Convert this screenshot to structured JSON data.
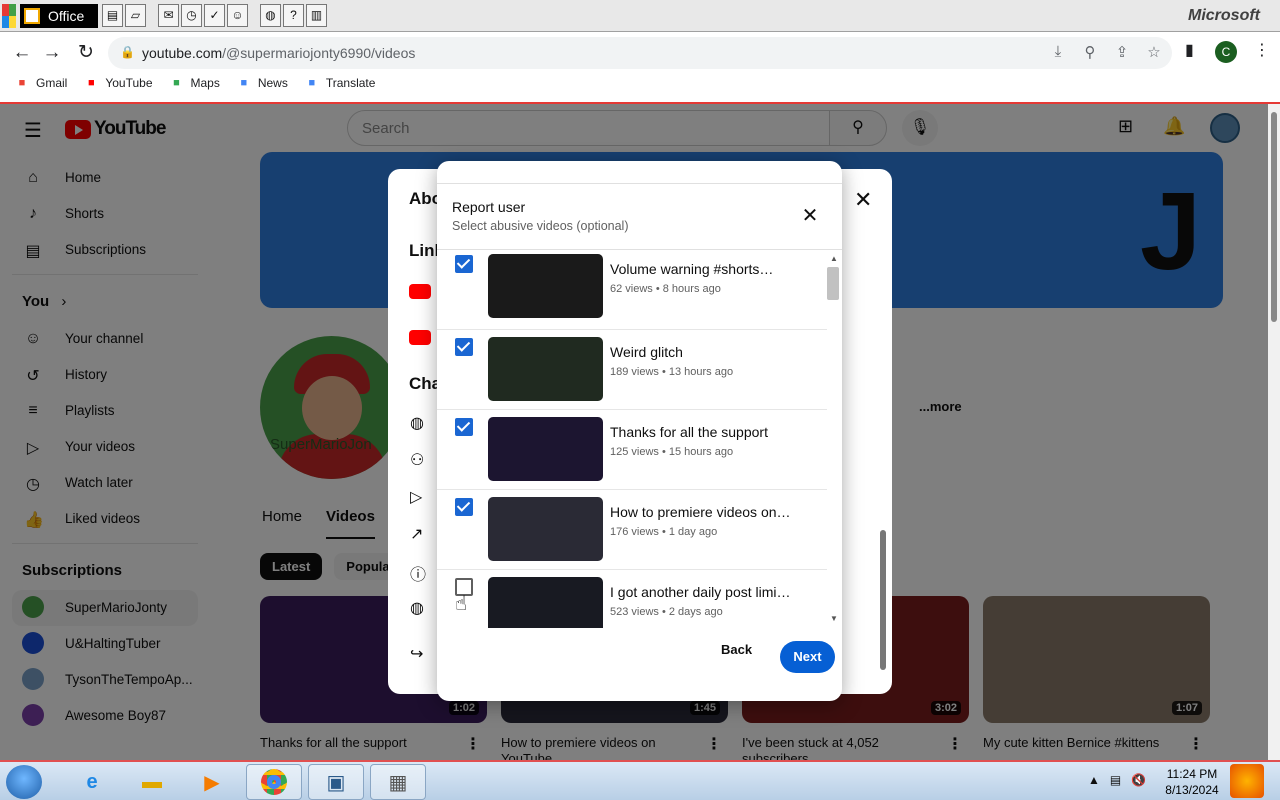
{
  "officebar": {
    "office_label": "Office",
    "microsoft_label": "Microsoft"
  },
  "browser": {
    "url_domain": "youtube.com",
    "url_path": "/@supermariojonty6990/videos",
    "profile_initial": "C",
    "bookmarks": [
      {
        "label": "Gmail",
        "icon": "gmail-icon",
        "color": "#ea4335"
      },
      {
        "label": "YouTube",
        "icon": "youtube-icon",
        "color": "#ff0000"
      },
      {
        "label": "Maps",
        "icon": "maps-icon",
        "color": "#34a853"
      },
      {
        "label": "News",
        "icon": "news-icon",
        "color": "#4285f4"
      },
      {
        "label": "Translate",
        "icon": "translate-icon",
        "color": "#4285f4"
      }
    ]
  },
  "youtube": {
    "logo_text": "YouTube",
    "search_placeholder": "Search",
    "sidebar": {
      "main": [
        {
          "label": "Home",
          "icon": "home-icon"
        },
        {
          "label": "Shorts",
          "icon": "shorts-icon"
        },
        {
          "label": "Subscriptions",
          "icon": "subscriptions-icon"
        }
      ],
      "you_label": "You",
      "you": [
        {
          "label": "Your channel",
          "icon": "your-channel-icon"
        },
        {
          "label": "History",
          "icon": "history-icon"
        },
        {
          "label": "Playlists",
          "icon": "playlists-icon"
        },
        {
          "label": "Your videos",
          "icon": "your-videos-icon"
        },
        {
          "label": "Watch later",
          "icon": "watch-later-icon"
        },
        {
          "label": "Liked videos",
          "icon": "liked-videos-icon"
        }
      ],
      "subscriptions_label": "Subscriptions",
      "subscriptions": [
        {
          "label": "SuperMarioJonty",
          "color": "#4aa04a"
        },
        {
          "label": "U&HaltingTuber",
          "color": "#1a4fd6"
        },
        {
          "label": "TysonTheTempoAp...",
          "color": "#7aa0c8"
        },
        {
          "label": "Awesome Boy87",
          "color": "#7b3fa8"
        }
      ]
    },
    "channel": {
      "avatar_text": "SuperMarioJon",
      "more_link": "...more",
      "tabs": [
        "Home",
        "Videos"
      ],
      "chips": [
        "Latest",
        "Popular"
      ]
    },
    "videos": [
      {
        "title": "Thanks for all the support",
        "duration": "1:02",
        "color": "#3a1c5c"
      },
      {
        "title": "How to premiere videos on YouTube",
        "duration": "1:45",
        "color": "#2b2b3b"
      },
      {
        "title": "I've been stuck at 4,052 subscribers",
        "duration": "3:02",
        "color": "#7a1c1c"
      },
      {
        "title": "My cute kitten Bernice #kittens",
        "duration": "1:07",
        "color": "#8a7a6a"
      }
    ]
  },
  "about_dialog": {
    "title": "Abo",
    "links_label": "Link",
    "channel_label": "Cha"
  },
  "report_dialog": {
    "title": "Report user",
    "subtitle": "Select abusive videos (optional)",
    "back_label": "Back",
    "next_label": "Next",
    "videos": [
      {
        "title": "Volume warning #shorts…",
        "meta": "62 views • 8 hours ago",
        "checked": true
      },
      {
        "title": "Weird glitch",
        "meta": "189 views • 13 hours ago",
        "checked": true
      },
      {
        "title": "Thanks for all the support",
        "meta": "125 views • 15 hours ago",
        "checked": true
      },
      {
        "title": "How to premiere videos on…",
        "meta": "176 views • 1 day ago",
        "checked": true
      },
      {
        "title": "I got another daily post limi…",
        "meta": "523 views • 2 days ago",
        "checked": false
      }
    ]
  },
  "taskbar": {
    "time": "11:24 PM",
    "date": "8/13/2024"
  }
}
